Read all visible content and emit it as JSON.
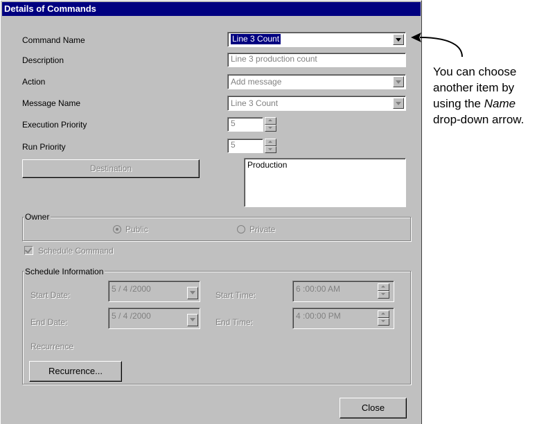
{
  "window": {
    "title": "Details of Commands"
  },
  "form": {
    "command_name_label": "Command Name",
    "command_name_value": "Line 3 Count",
    "description_label": "Description",
    "description_value": "Line 3 production count",
    "action_label": "Action",
    "action_value": "Add message",
    "message_name_label": "Message Name",
    "message_name_value": "Line 3 Count",
    "execution_priority_label": "Execution Priority",
    "execution_priority_value": "5",
    "run_priority_label": "Run Priority",
    "run_priority_value": "5",
    "destination_button": "Destination",
    "destination_list": [
      "Production"
    ]
  },
  "owner": {
    "group_label": "Owner",
    "public_label": "Public",
    "private_label": "Private",
    "selected": "Public"
  },
  "schedule_command_label": "Schedule Command",
  "schedule_command_checked": true,
  "schedule": {
    "group_label": "Schedule Information",
    "start_date_label": "Start Date:",
    "start_date_value": "5 / 4 /2000",
    "start_time_label": "Start Time:",
    "start_time_value": "6 :00:00 AM",
    "end_date_label": "End Date:",
    "end_date_value": "5 / 4 /2000",
    "end_time_label": "End Time:",
    "end_time_value": "4 :00:00 PM",
    "recurrence_label": "Recurrence",
    "recurrence_button": "Recurrence..."
  },
  "close_button": "Close",
  "callout": {
    "line1": "You can choose",
    "line2": "another item by",
    "line3_pre": "using the ",
    "line3_em": "Name",
    "line4": "drop-down arrow."
  },
  "colors": {
    "title_bar": "#000080",
    "dialog_bg": "#c0c0c0",
    "selection": "#000080"
  }
}
